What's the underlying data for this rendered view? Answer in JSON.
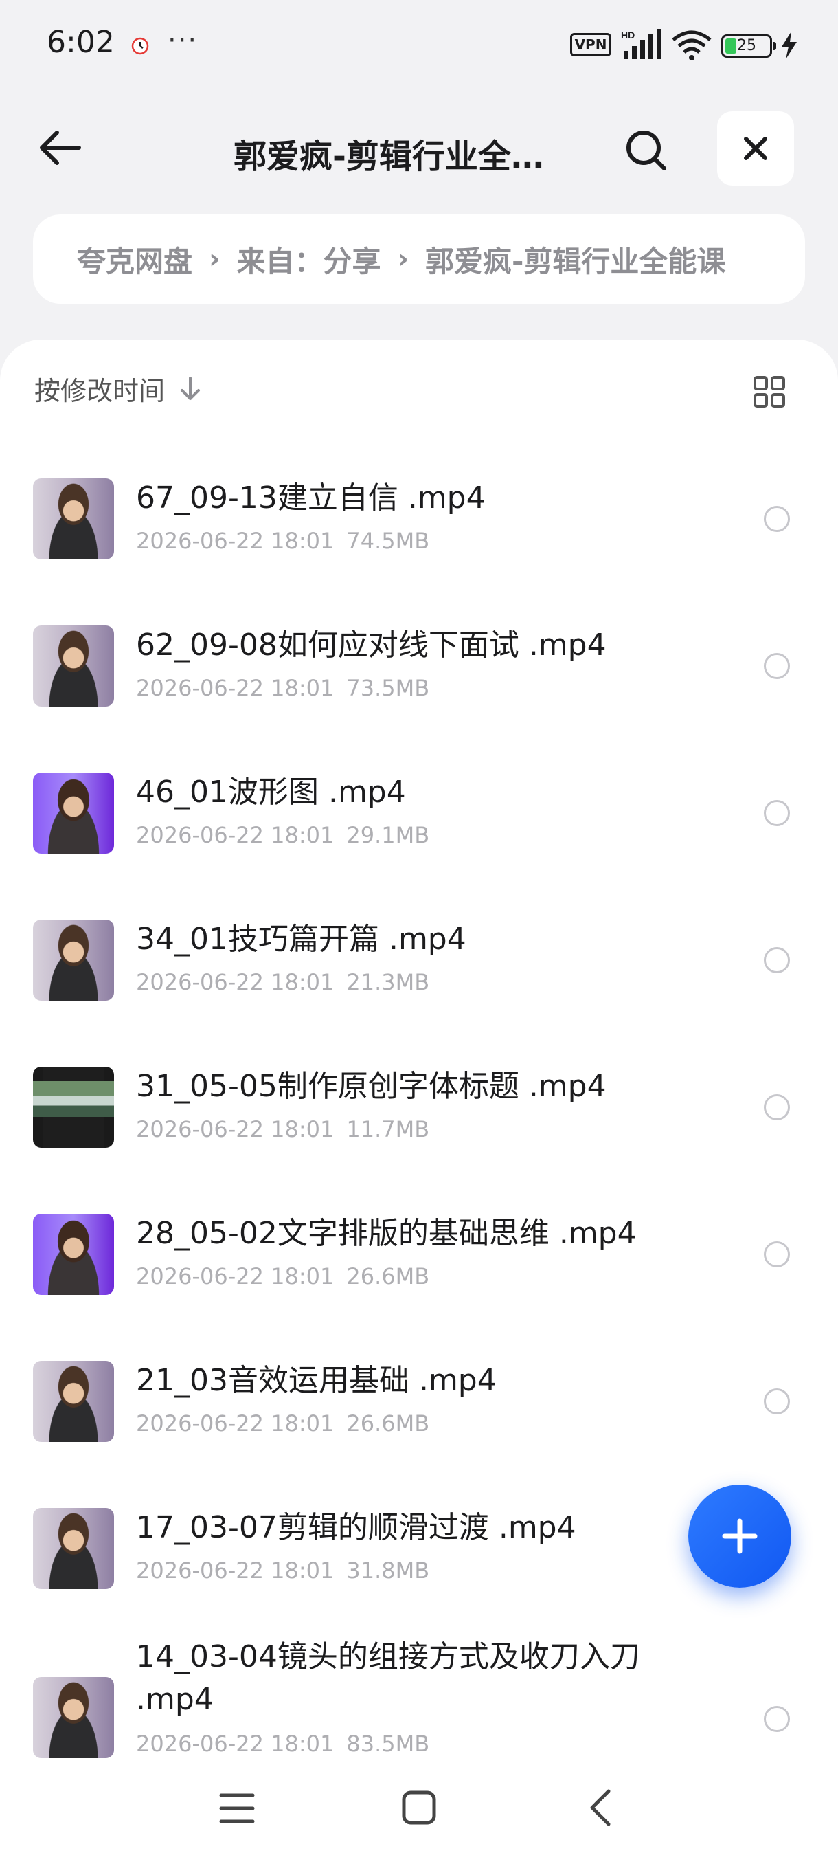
{
  "status_bar": {
    "time": "6:02",
    "dots": "···",
    "vpn": "VPN",
    "battery_level": "25",
    "battery_fraction": 0.25,
    "icons": [
      "alarm-icon",
      "signal-icon",
      "wifi-icon",
      "battery-icon",
      "charging-icon"
    ]
  },
  "header": {
    "title": "郭爱疯-剪辑行业全…",
    "back_icon": "arrow-left-icon",
    "search_icon": "search-icon",
    "close_icon": "close-icon"
  },
  "breadcrumb": {
    "items": [
      "夸克网盘",
      "来自：分享",
      "郭爱疯-剪辑行业全能课"
    ]
  },
  "sort": {
    "label": "按修改时间",
    "direction_icon": "arrow-down-icon",
    "view_icon": "grid-view-icon"
  },
  "files": [
    {
      "name": "67_09-13建立自信 .mp4",
      "date": "2026-06-22 18:01",
      "size": "74.5MB",
      "thumb": "person"
    },
    {
      "name": "62_09-08如何应对线下面试 .mp4",
      "date": "2026-06-22 18:01",
      "size": "73.5MB",
      "thumb": "person"
    },
    {
      "name": "46_01波形图 .mp4",
      "date": "2026-06-22 18:01",
      "size": "29.1MB",
      "thumb": "person-purple"
    },
    {
      "name": "34_01技巧篇开篇 .mp4",
      "date": "2026-06-22 18:01",
      "size": "21.3MB",
      "thumb": "person"
    },
    {
      "name": "31_05-05制作原创字体标题 .mp4",
      "date": "2026-06-22 18:01",
      "size": "11.7MB",
      "thumb": "editor"
    },
    {
      "name": "28_05-02文字排版的基础思维 .mp4",
      "date": "2026-06-22 18:01",
      "size": "26.6MB",
      "thumb": "person-purple"
    },
    {
      "name": "21_03音效运用基础 .mp4",
      "date": "2026-06-22 18:01",
      "size": "26.6MB",
      "thumb": "person"
    },
    {
      "name": "17_03-07剪辑的顺滑过渡 .mp4",
      "date": "2026-06-22 18:01",
      "size": "31.8MB",
      "thumb": "person"
    },
    {
      "name": "14_03-04镜头的组接方式及收刀入刀 .mp4",
      "date": "2026-06-22 18:01",
      "size": "83.5MB",
      "thumb": "person"
    }
  ],
  "fab": {
    "icon": "plus-icon"
  },
  "nav": {
    "icons": [
      "menu-icon",
      "home-icon",
      "back-icon"
    ]
  },
  "colors": {
    "accent": "#1a66ff",
    "background": "#f2f2f4",
    "meta_text": "#aeaeb2"
  }
}
